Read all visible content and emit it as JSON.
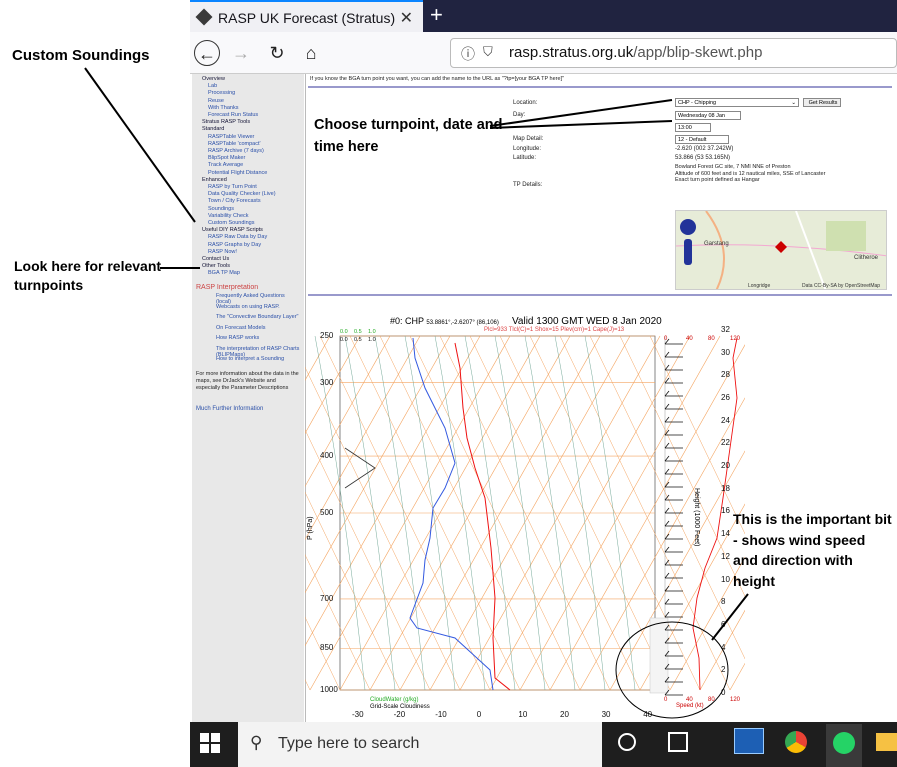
{
  "browser": {
    "tab_title": "RASP UK Forecast (Stratus)",
    "url_domain": "rasp.stratus.org.uk",
    "url_path": "/app/blip-skewt.php"
  },
  "sidebar": {
    "items": [
      "Overview",
      "Lab",
      "Processing",
      "Reuse",
      "With Thanks",
      "Forecast Run Status",
      "Stratus RASP Tools",
      "Standard",
      "RASPTable Viewer",
      "RASPTable 'compact'",
      "RASP Archive (7 days)",
      "BlipSpot Maker",
      "Track Average",
      "Potential Flight Distance",
      "Enhanced",
      "RASP by Turn Point",
      "Data Quality Checker (Live)",
      "Town / City Forecasts",
      "Soundings",
      "Variability Check",
      "Custom Soundings",
      "Useful DIY RASP Scripts",
      "RASP Raw Data by Day",
      "RASP Graphs by Day",
      "RASP Now!",
      "Contact Us",
      "Other Tools",
      "BGA TP Map"
    ],
    "section_title": "RASP Interpretation",
    "interp_items": [
      "Frequently Asked Questions (local)",
      "Webcasts on using RASP.",
      "The \"Convective Boundary Layer\"",
      "On Forecast Models",
      "How RASP works",
      "The interpretation of RASP Charts (BLIPMaps)",
      "How to interpret a Sounding"
    ],
    "info_text": "For more information about the data in the maps, see DrJack's Website and especially the Parameter Descriptions",
    "further_info": "Much Further Information"
  },
  "form": {
    "hint": "If you know the BGA turn point you want, you can add the name to the URL as \"?tp=[your BGA TP here]\"",
    "location_label": "Location:",
    "location_value": "CHP - Chipping",
    "get_results": "Get Results",
    "day_label": "Day:",
    "day_value": "Wednesday 08 Jan",
    "time_value": "13:00",
    "map_detail_label": "Map Detail:",
    "map_detail_value": "12 - Default",
    "longitude_label": "Longitude:",
    "longitude_value": "-2.620 (002 37.242W)",
    "latitude_label": "Latitude:",
    "latitude_value": "53.866 (53 53.165N)",
    "tp_details_label": "TP Details:",
    "tp_details": "Bowland Forest GC site, 7 NMI NNE of Preston\nAltitude of 600 feet and is 12 nautical miles, SSE of Lancaster\nExact turn point defined as Hangar",
    "map_labels": [
      "Garstang",
      "Clitheroe",
      "Longridge"
    ],
    "map_credit": "Data CC-By-SA by OpenStreetMap"
  },
  "chart": {
    "title": "#0: CHP",
    "coords": "53.8861°,-2.6207° (86,106)",
    "valid": "Valid 1300 GMT WED 8 Jan 2020",
    "subtitle": "Plcl=933 Tlcl(C)=1 Shox=15 Plev(cm)=1 Cape(J)=13",
    "ylabel": "P (hPa)",
    "height_label": "Height (1000 Feet)",
    "pressure_ticks": [
      "250",
      "300",
      "400",
      "500",
      "700",
      "850",
      "1000"
    ],
    "temp_ticks": [
      "-30",
      "-20",
      "-10",
      "0",
      "10",
      "20",
      "30",
      "40"
    ],
    "height_ticks": [
      "0",
      "2",
      "4",
      "6",
      "8",
      "10",
      "12",
      "14",
      "16",
      "18",
      "20",
      "22",
      "24",
      "26",
      "28",
      "30",
      "32"
    ],
    "speed_ticks": [
      "0",
      "40",
      "80",
      "120"
    ],
    "speed_label": "Speed (kt)",
    "cloud_top": [
      "0.0",
      "0.5",
      "1.0"
    ],
    "cloud_labels": [
      "CloudWater (g/kg)",
      "Grid-Scale Cloudiness"
    ]
  },
  "annotations": {
    "custom_soundings": "Custom Soundings",
    "turnpoints": "Look here for relevant turnpoints",
    "choose": "Choose turnpoint, date and time here",
    "important": "This is the important bit - shows wind speed and direction with height"
  },
  "taskbar": {
    "search_placeholder": "Type here to search"
  }
}
